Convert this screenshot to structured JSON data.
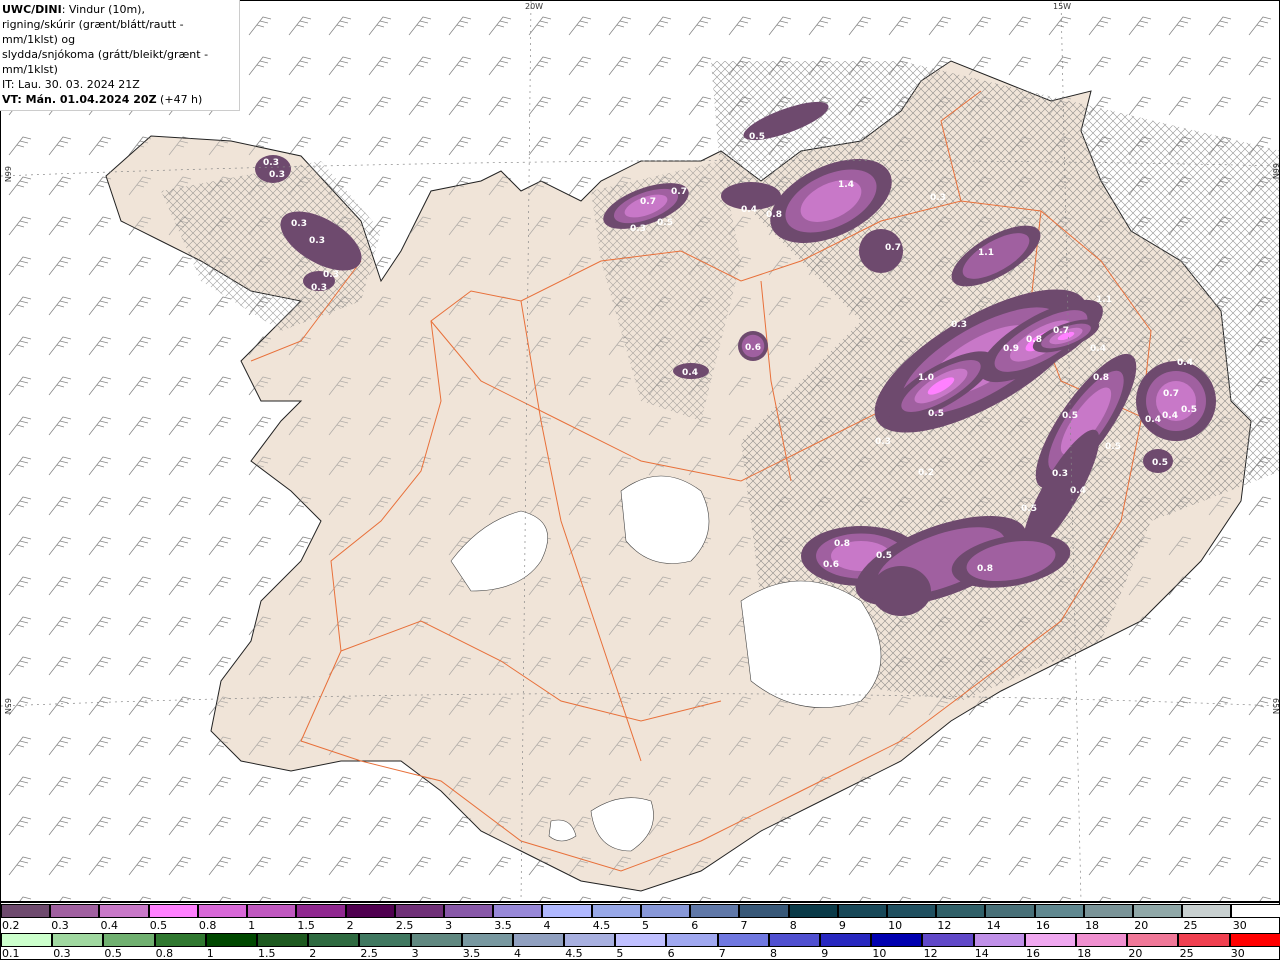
{
  "info": {
    "model": "UWC/DINI",
    "line1_rest": ": Vindur (10m),",
    "line2": "rigning/skúrir (grænt/blátt/rautt - mm/1klst) og",
    "line3": "slydda/snjókoma (grátt/bleikt/grænt - mm/1klst)",
    "it": "IT: Lau. 30. 03. 2024 21Z",
    "vt_bold": "VT: Mán. 01.04.2024 20Z",
    "vt_rest": " (+47 h)"
  },
  "axes": {
    "lon_top": [
      "20W",
      "15W"
    ],
    "lat_left": [
      "66N",
      "65N"
    ],
    "lat_right": [
      "66N",
      "65N"
    ]
  },
  "map": {
    "land_color": "#f0e4d8",
    "road_color": "#e8703a",
    "sea_color": "#ffffff",
    "precip_labels": [
      "0.3",
      "0.3",
      "0.3",
      "0.3",
      "0.3",
      "0.3",
      "0.5",
      "1.4",
      "0.3",
      "0.7",
      "0.7",
      "0.3",
      "0.5",
      "0.4",
      "0.8",
      "0.7",
      "1.1",
      "1.1",
      "0.3",
      "0.9",
      "0.8",
      "0.7",
      "0.4",
      "0.6",
      "0.4",
      "1.0",
      "0.8",
      "0.5",
      "0.5",
      "0.4",
      "0.7",
      "0.4",
      "0.4",
      "0.5",
      "0.3",
      "0.5",
      "0.2",
      "0.3",
      "0.4",
      "0.5",
      "0.5",
      "0.8",
      "0.5",
      "0.6",
      "0.8"
    ]
  },
  "legend_snow": {
    "labels": [
      "0.2",
      "0.3",
      "0.4",
      "0.5",
      "0.8",
      "1",
      "1.5",
      "2",
      "2.5",
      "3",
      "3.5",
      "4",
      "4.5",
      "5",
      "6",
      "7",
      "8",
      "9",
      "10",
      "12",
      "14",
      "16",
      "18",
      "20",
      "25",
      "30"
    ],
    "colors": [
      "#6e4a6e",
      "#a060a0",
      "#c878c8",
      "#ff80ff",
      "#d868d8",
      "#c058c0",
      "#902890",
      "#500050",
      "#703078",
      "#8858a8",
      "#9888d8",
      "#b0b8ff",
      "#98a8e8",
      "#8898d8",
      "#6078a8",
      "#385878",
      "#0a3a48",
      "#184858",
      "#205060",
      "#306068",
      "#487078",
      "#608890",
      "#7a9498",
      "#90a8a8",
      "#c8d0d0",
      "#ffffff"
    ]
  },
  "legend_rain": {
    "labels": [
      "0.1",
      "0.3",
      "0.5",
      "0.8",
      "1",
      "1.5",
      "2",
      "2.5",
      "3",
      "3.5",
      "4",
      "4.5",
      "5",
      "6",
      "7",
      "8",
      "9",
      "10",
      "12",
      "14",
      "16",
      "18",
      "20",
      "25",
      "30"
    ],
    "colors": [
      "#ccffcc",
      "#a0d8a0",
      "#70b070",
      "#307830",
      "#004800",
      "#1e5a20",
      "#2e6a40",
      "#407860",
      "#608880",
      "#7898a0",
      "#90a0c0",
      "#a8b0e0",
      "#c0c0ff",
      "#a0a8f0",
      "#7078e0",
      "#5050d0",
      "#2828c0",
      "#0000b0",
      "#6048c8",
      "#c090e8",
      "#f0a8f0",
      "#f090d0",
      "#f07898",
      "#f04050",
      "#ff0000"
    ]
  }
}
